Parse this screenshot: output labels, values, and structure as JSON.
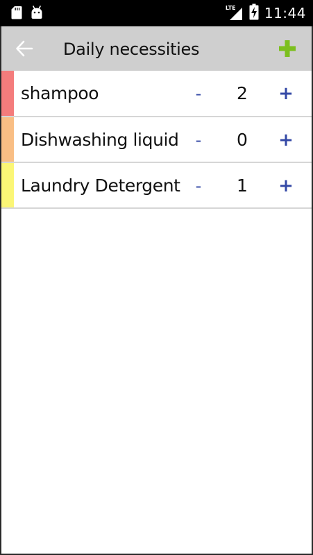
{
  "status_bar": {
    "time": "11:44",
    "network": "LTE",
    "icons": [
      "sd-card-icon",
      "android-icon",
      "lte-signal-icon",
      "battery-charging-icon"
    ]
  },
  "app_bar": {
    "title": "Daily necessities",
    "back_icon": "arrow-left-icon",
    "add_icon": "plus-icon",
    "add_color": "#7cbf1e",
    "background": "#cfcfcf"
  },
  "items": [
    {
      "name": "shampoo",
      "count": "2",
      "color": "#f47c7c",
      "minus": "-",
      "plus": "+"
    },
    {
      "name": "Dishwashing liquid",
      "count": "0",
      "color": "#f9be84",
      "minus": "-",
      "plus": "+"
    },
    {
      "name": "Laundry Detergent",
      "count": "1",
      "color": "#fbf676",
      "minus": "-",
      "plus": "+"
    }
  ],
  "accent_color": "#3449a6"
}
